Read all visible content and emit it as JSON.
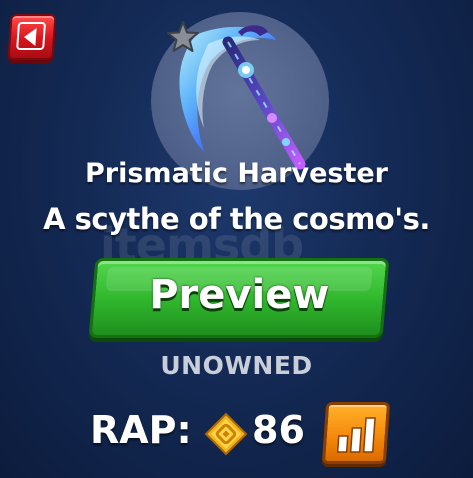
{
  "item": {
    "name": "Prismatic Harvester",
    "description": "A scythe of the cosmo's.",
    "status": "UNOWNED",
    "rap_label": "RAP:",
    "rap_value": "86"
  },
  "buttons": {
    "preview_label": "Preview",
    "back_icon": "back-arrow-icon",
    "chart_icon": "bar-chart-icon"
  },
  "watermark": "itemsdb",
  "colors": {
    "background": "#142a55",
    "back_button": "#d7141c",
    "preview_button": "#2fb52c",
    "chart_button": "#f58a0c",
    "coin": "#f2b21c",
    "status_text": "#c9cfda"
  }
}
